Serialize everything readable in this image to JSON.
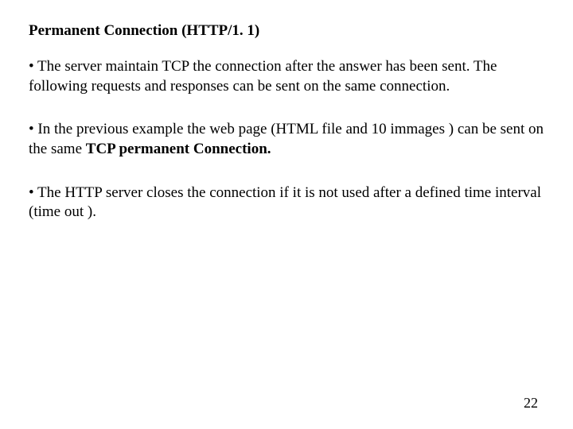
{
  "title": "Permanent Connection (HTTP/1. 1)",
  "bullet1": "• The server maintain TCP  the connection after the answer has been sent. The following requests and responses can be sent on the same connection.",
  "bullet2_pre": "• In the previous example the web page (HTML file and 10 immages ) can be sent on the same ",
  "bullet2_bold": "TCP permanent Connection.",
  "bullet3": "• The HTTP server closes the connection if  it is not used after a defined  time interval (time out ).",
  "pageNumber": "22"
}
